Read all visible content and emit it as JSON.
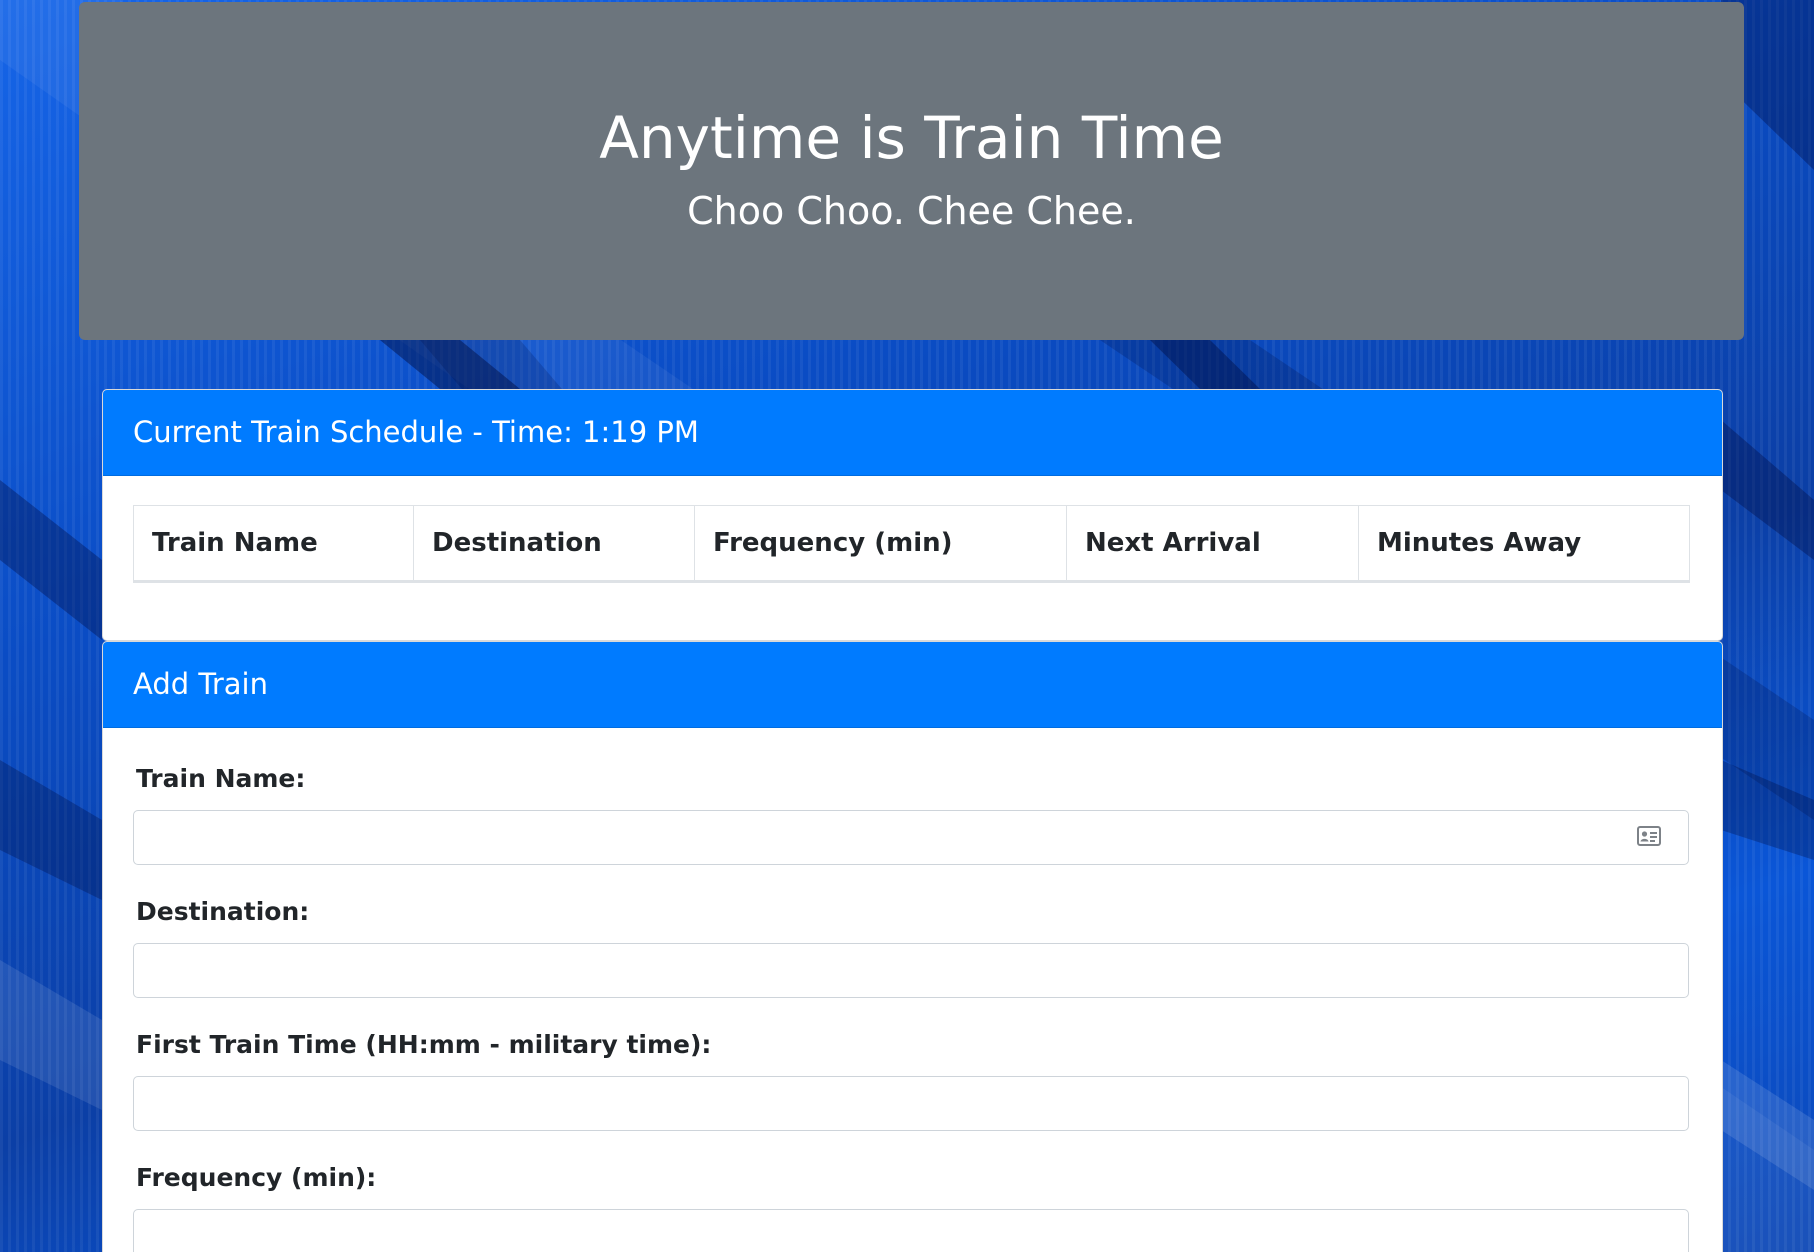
{
  "header": {
    "title": "Anytime is Train Time",
    "subtitle": "Choo Choo. Chee Chee."
  },
  "schedule": {
    "heading": "Current Train Schedule - Time: 1:19 PM",
    "columns": [
      "Train Name",
      "Destination",
      "Frequency (min)",
      "Next Arrival",
      "Minutes Away"
    ],
    "rows": []
  },
  "add_train": {
    "heading": "Add Train",
    "fields": [
      {
        "label": "Train Name:",
        "value": "",
        "icon": "contact-card-icon"
      },
      {
        "label": "Destination:",
        "value": ""
      },
      {
        "label": "First Train Time (HH:mm - military time):",
        "value": ""
      },
      {
        "label": "Frequency (min):",
        "value": ""
      }
    ]
  },
  "colors": {
    "header_bg": "#6c757d",
    "card_header_bg": "#007bff",
    "page_bg": "#0a4fc7"
  }
}
